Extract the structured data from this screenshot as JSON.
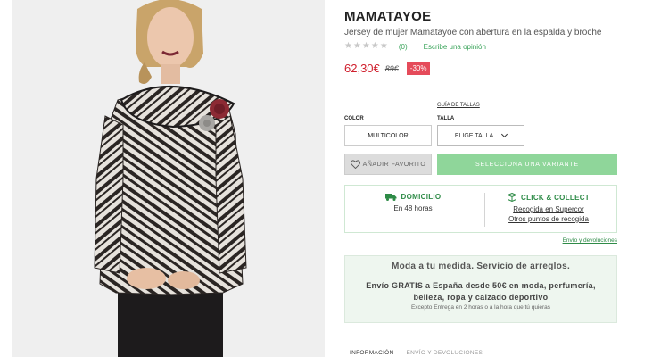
{
  "product": {
    "brand": "MAMATAYOE",
    "subtitle": "Jersey de mujer Mamatayoe con abertura en la espalda y broche",
    "rating": {
      "stars": 0,
      "max": 5,
      "count_label": "(0)",
      "write_review": "Escribe una opinión"
    },
    "price": {
      "current": "62,30€",
      "old": "89€",
      "discount": "-30%"
    }
  },
  "selectors": {
    "size_guide": "GUÍA DE TALLAS",
    "color_label": "COLOR",
    "color_value": "MULTICOLOR",
    "size_label": "TALLA",
    "size_placeholder": "ELIGE TALLA"
  },
  "actions": {
    "favorite": "AÑADIR FAVORITO",
    "select_variant": "SELECCIONA UNA VARIANTE"
  },
  "delivery": {
    "home": {
      "title": "DOMICILIO",
      "link": "En 48 horas"
    },
    "click_collect": {
      "title": "CLICK & COLLECT",
      "link1": "Recogida en Supercor",
      "link2": "Otros puntos de recogida"
    },
    "shipping_link": "Envío y devoluciones"
  },
  "promo": {
    "title": "Moda a tu medida. Servicio de arreglos.",
    "text": "Envío GRATIS a España desde 50€ en moda, perfumería, belleza, ropa y calzado deportivo",
    "note": "Excepto Entrega en 2 horas o a la hora que tú quieras"
  },
  "tabs": [
    {
      "label": "INFORMACIÓN"
    },
    {
      "label": "ENVÍO Y DEVOLUCIONES"
    }
  ],
  "colors": {
    "price": "#d0202e",
    "discount_bg": "#e54b5a",
    "accent_green": "#2e8b47",
    "variant_button": "#8fd69a",
    "promo_bg": "#eef6ef"
  },
  "icons": {
    "favorite": "heart-icon",
    "home": "truck-icon",
    "click_collect": "box-icon",
    "size_dropdown": "chevron-down-icon"
  }
}
